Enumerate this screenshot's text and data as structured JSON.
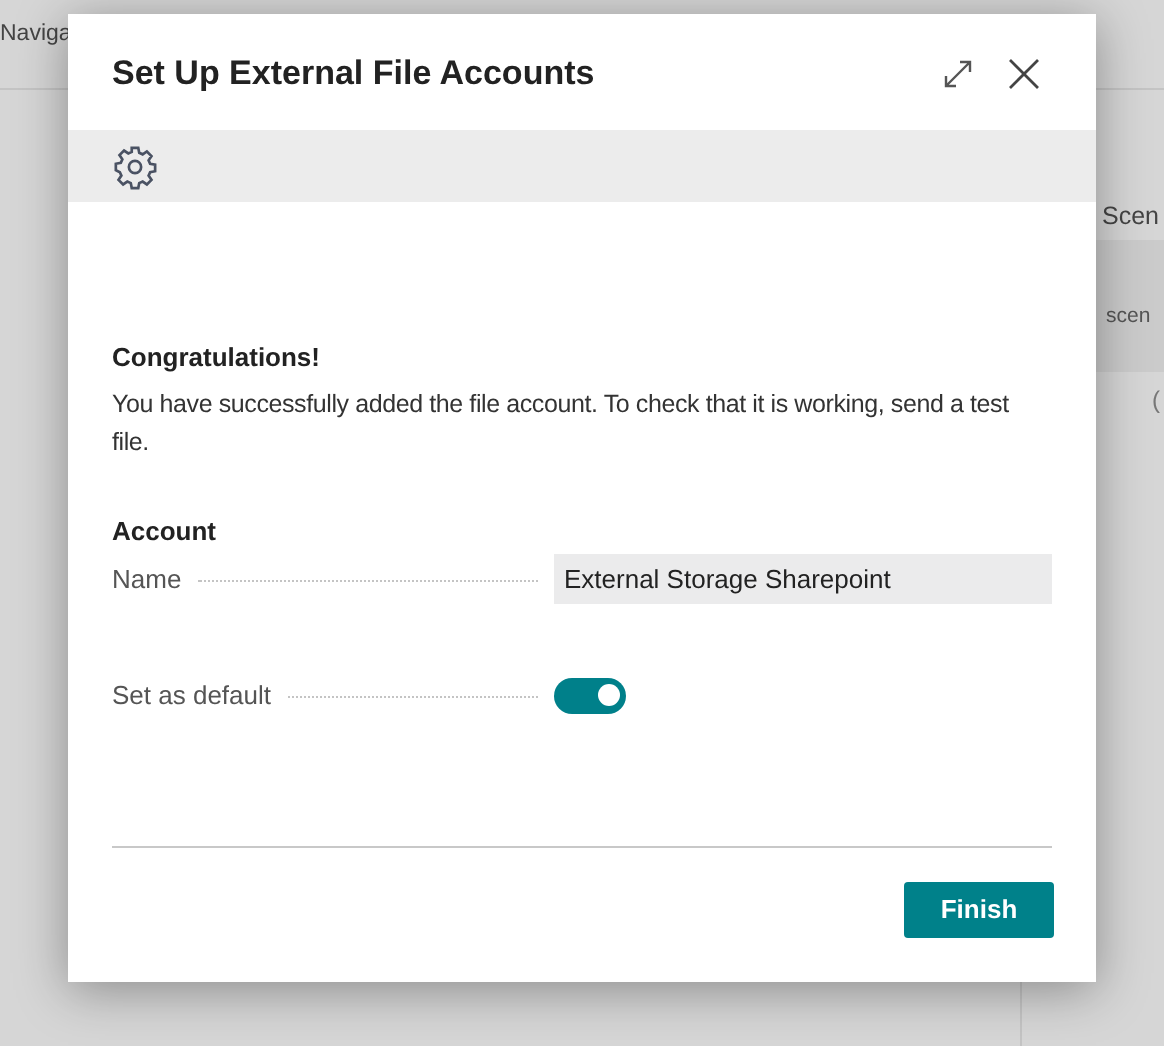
{
  "background": {
    "nav_text": "Naviga",
    "panel_title": "Scen",
    "panel_text": "scen",
    "panel_mark": "("
  },
  "dialog": {
    "title": "Set Up External File Accounts",
    "heading": "Congratulations!",
    "message": "You have successfully added the file account. To check that it is working, send a test file.",
    "section": "Account",
    "fields": [
      {
        "kind": "text",
        "label": "Name",
        "value": "External Storage Sharepoint"
      },
      {
        "kind": "toggle",
        "label": "Set as default",
        "on": true
      }
    ],
    "buttons": [
      "Finish"
    ]
  }
}
